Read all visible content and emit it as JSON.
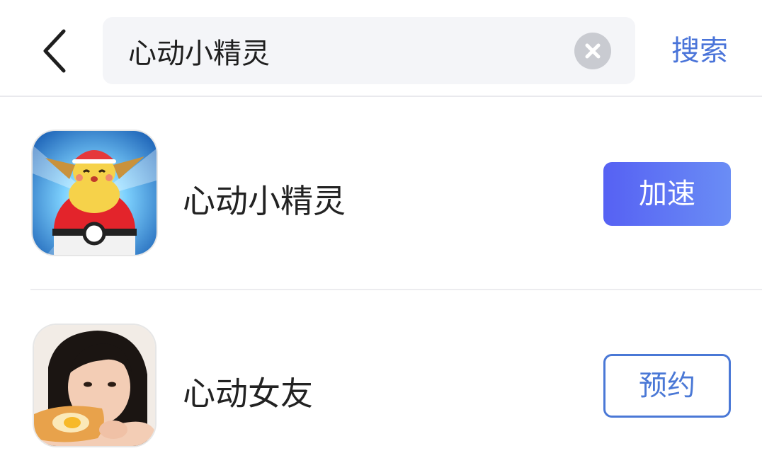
{
  "header": {
    "search": {
      "value": "心动小精灵",
      "placeholder": ""
    },
    "search_button_label": "搜索"
  },
  "results": [
    {
      "name": "心动小精灵",
      "action_label": "加速",
      "action_style": "filled",
      "icon": "pikachu-pokeball-game-icon"
    },
    {
      "name": "心动女友",
      "action_label": "预约",
      "action_style": "outline",
      "icon": "girl-eating-toast-game-icon"
    }
  ],
  "colors": {
    "accent": "#4a74d9",
    "button_gradient_start": "#5661f3",
    "button_gradient_end": "#6a8df5",
    "search_bg": "#f4f5f8"
  }
}
